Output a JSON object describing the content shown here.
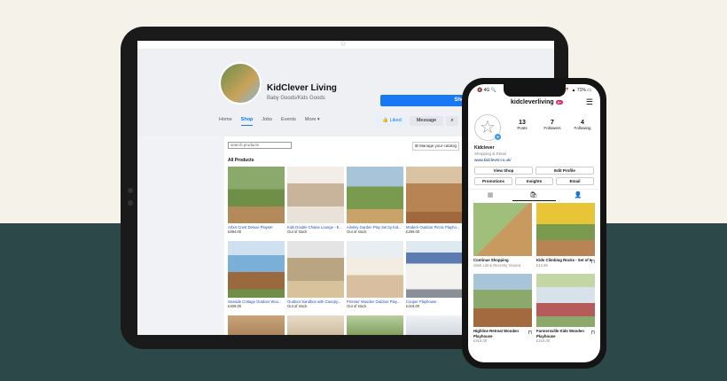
{
  "tablet": {
    "page_name": "KidClever Living",
    "page_category": "Baby Goods/Kids Goods",
    "shop_now": "Shop Now",
    "nav": [
      "Home",
      "Shop",
      "Jobs",
      "Events",
      "More ▾"
    ],
    "liked": "👍 Liked",
    "message": "Message",
    "search_placeholder": "search products",
    "manage_catalog": "⊞ Manage your catalog",
    "all_products": "All Products",
    "products": [
      {
        "name": "Arbor Crest Deluxe Playset",
        "price": "£894.00"
      },
      {
        "name": "Kids Double Chaise Lounge - E...",
        "price": "Out of stock"
      },
      {
        "name": "Ainsley Garden Play Set by Kid...",
        "price": "Out of stock"
      },
      {
        "name": "Modern Outdoor Picnic Playho...",
        "price": "£269.00"
      },
      {
        "name": "Seaside Cottage Outdoor Woo...",
        "price": "£409.00"
      },
      {
        "name": "Outdoor Sandbox with Canopy...",
        "price": "Out of stock"
      },
      {
        "name": "Premier Wooden Outdoor Play...",
        "price": "Out of stock"
      },
      {
        "name": "Cooper Playhouse",
        "price": "£419.00"
      }
    ]
  },
  "phone": {
    "time": "🔇 4G 🔍",
    "battery": "📍 ▲ 71% ▭",
    "username": "kidcleverliving",
    "badge": "9+",
    "menu": "☰",
    "avatar": "☆",
    "plus": "+",
    "stats": [
      {
        "n": "13",
        "l": "Posts"
      },
      {
        "n": "7",
        "l": "Followers"
      },
      {
        "n": "4",
        "l": "Following"
      }
    ],
    "bio_name": "Kidclever",
    "bio_category": "Shopping & Retail",
    "bio_link": "www.kidclever.co.uk/",
    "buttons": [
      "View Shop",
      "Edit Profile",
      "Promotions",
      "Insights",
      "Email"
    ],
    "tabs": [
      "▦",
      "🛍",
      "👤"
    ],
    "items": [
      {
        "title": "Continue Shopping",
        "sub": "Wish List & Recently Viewed",
        "bm": ""
      },
      {
        "title": "Kids Climbing Rocks - Set of 6",
        "sub": "£12.99",
        "bm": "⊓"
      },
      {
        "title": "Highline Retreat Wooden Playhouse",
        "sub": "£419.00",
        "bm": "⊓"
      },
      {
        "title": "Farmersville Kids Wooden Playhouse",
        "sub": "£419.00",
        "bm": "⊓"
      }
    ]
  }
}
